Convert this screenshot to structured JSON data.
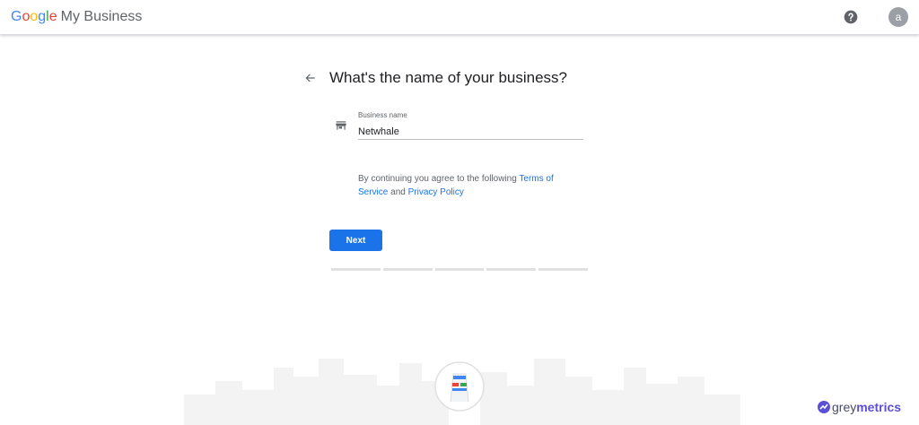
{
  "header": {
    "logo_google": [
      "G",
      "o",
      "o",
      "g",
      "l",
      "e"
    ],
    "logo_product": "My Business",
    "help_icon": "help-circle-icon",
    "avatar_initial": "a"
  },
  "main": {
    "back_icon": "arrow-back-icon",
    "title": "What's the name of your business?",
    "field": {
      "icon": "storefront-icon",
      "label": "Business name",
      "value": "Netwhale"
    },
    "terms": {
      "prefix": "By continuing you agree to the following ",
      "terms_link": "Terms of Service",
      "conjunction": " and ",
      "privacy_link": "Privacy Policy"
    },
    "next_button": "Next",
    "progress_steps": 5
  },
  "footer": {
    "illustration": "storefront-sign-illustration",
    "brand_prefix": "grey",
    "brand_suffix": "metrics"
  },
  "colors": {
    "accent": "#1a73e8",
    "text": "#202124",
    "muted": "#5f6368",
    "brand": "#5b4fd6"
  }
}
